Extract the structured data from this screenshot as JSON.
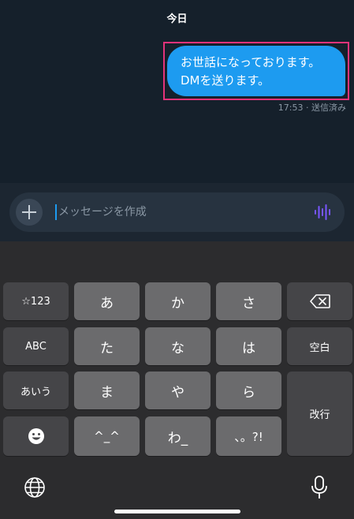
{
  "chat": {
    "day_label": "今日",
    "message": {
      "line1": "お世話になっております。",
      "line2": "DMを送ります。",
      "time": "17:53",
      "status": "送信済み"
    }
  },
  "composer": {
    "placeholder": "メッセージを作成"
  },
  "keyboard": {
    "keys": {
      "num": "☆123",
      "a": "あ",
      "ka": "か",
      "sa": "さ",
      "abc": "ABC",
      "ta": "た",
      "na": "な",
      "ha": "は",
      "space": "空白",
      "aiu": "あいう",
      "ma": "ま",
      "ya": "や",
      "ra": "ら",
      "enter": "改行",
      "kaomoji": "^_^",
      "wa": "わ_",
      "punct": "、。?!"
    }
  },
  "colors": {
    "background": "#15202b",
    "bubble": "#1d9bf0",
    "highlight_frame": "#e4337a",
    "voice_icon": "#7856ff"
  },
  "icons": {
    "plus": "plus-icon",
    "voice": "voice-waveform-icon",
    "backspace": "backspace-icon",
    "emoji": "emoji-icon",
    "globe": "globe-icon",
    "mic": "microphone-icon"
  }
}
